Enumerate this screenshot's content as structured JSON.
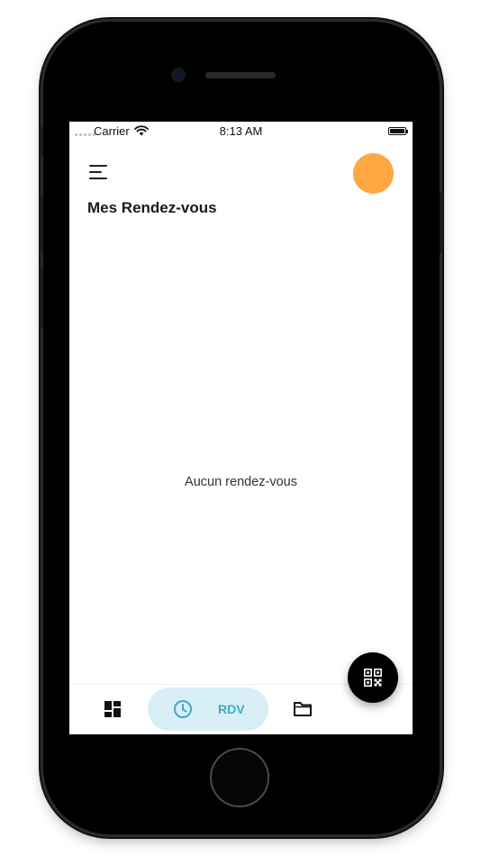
{
  "status_bar": {
    "carrier": "Carrier",
    "time": "8:13 AM"
  },
  "header": {
    "menu_icon": "hamburger-menu-icon",
    "avatar_color": "#FEA743",
    "title": "Mes Rendez-vous"
  },
  "main": {
    "empty_message": "Aucun rendez-vous"
  },
  "bottom_nav": {
    "items": [
      {
        "icon": "dashboard-icon",
        "label": ""
      },
      {
        "icon": "clock-icon",
        "label": "RDV",
        "active": true
      },
      {
        "icon": "folder-icon",
        "label": ""
      }
    ],
    "active_color": "#3FA9C8",
    "active_bg": "#D9EFF6"
  },
  "fab": {
    "icon": "qr-code-icon"
  }
}
